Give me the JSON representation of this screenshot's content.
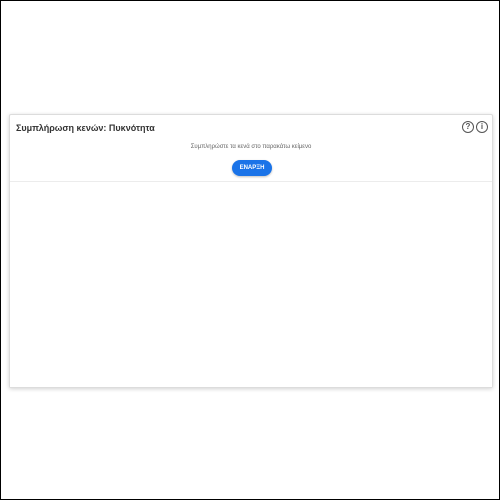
{
  "activity": {
    "title": "Συμπλήρωση κενών: Πυκνότητα",
    "instruction": "Συμπληρώστε τα κενά στο παρακάτω κείμενο",
    "start_label": "ΕΝΑΡΞΗ"
  },
  "icons": {
    "help_glyph": "?",
    "info_glyph": "i",
    "help": "question-circle-icon",
    "info": "info-circle-icon"
  },
  "colors": {
    "accent": "#1a73e8",
    "title_text": "#333333",
    "instruction_text": "#666666"
  }
}
